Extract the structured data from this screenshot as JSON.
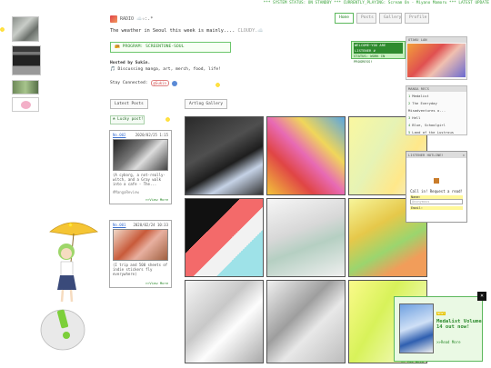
{
  "ticker": "*** SYSTEM STATUS: ON STANDBY *** CURRENTLY_PLAYING: Scream On - Miyano Mamoru *** LATEST UPDATE",
  "header": {
    "title": "RADIO ☁️☆:.*",
    "weather_text": "The weather in Seoul this week is mainly....",
    "weather_value": "CLOUDY.☁️"
  },
  "nav": {
    "tabs": [
      "Home",
      "Posts",
      "Gallery",
      "Profile"
    ],
    "active": "Home"
  },
  "program": {
    "label": "PROGRAM: SCREENTONE-SOUL"
  },
  "intro": {
    "hosted_by": "Hosted by Sukin.",
    "topics": "🎵 Discussing manga, art, merch, food, life!",
    "stay_connected": "Stay Connected:",
    "contact_pill": "@Sukin",
    "contact_icon": "chat-icon"
  },
  "welcome": {
    "line1": "WELCOME~YOU ARE LISTENER #",
    "line2": "STATUS: WORK IN PROGRESS!"
  },
  "latest_posts": {
    "title": "Latest Posts",
    "lucky": "☘ Lucky post!",
    "posts": [
      {
        "no": "No.002",
        "date": "2020/02/25 1:15",
        "text": "(A cyborg, a not-really-witch, and a Gray walk into a cafe - The...",
        "tag": "#MangaReview",
        "more": ">>View More"
      },
      {
        "no": "No.001",
        "date": "2020/02/24 10:33",
        "text": "(I trip and 500 sheets of indie stickers fly everywhere)",
        "tag": "",
        "more": ">>View More"
      }
    ]
  },
  "gallery": {
    "title": "Artlog Gallery",
    "more": ">> See More"
  },
  "sidebar": {
    "user_title": "OTAKU LAN",
    "manga_title": "MANGA RECS",
    "manga_recs": [
      "Medalist",
      "The Everyday Misadventures o...",
      "Hell",
      "Blue, Schoolgirl",
      "Land of the Lustrous"
    ],
    "listener_title": "LISTENER HOTLINE!",
    "listener_cta": "Call in! Request a read!",
    "name_label": "Name:",
    "name_placeholder": "Anonymous",
    "email_label": "Email:"
  },
  "popup": {
    "badge": "NEW!",
    "message": "Medalist Volume 14 out now!",
    "read_more": ">>Read More",
    "close": "×"
  }
}
